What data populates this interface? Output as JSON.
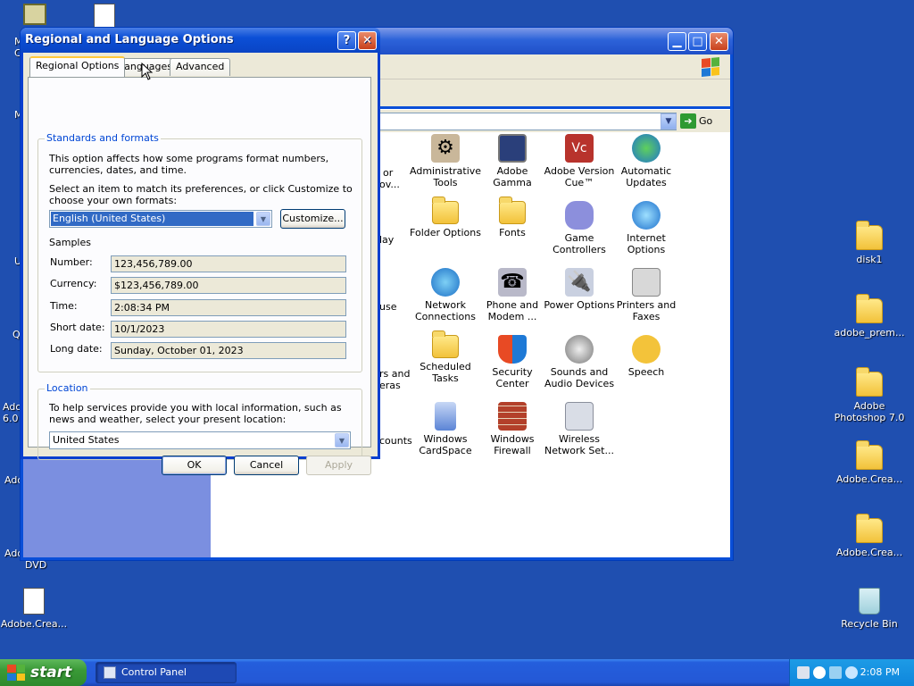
{
  "desktop": {
    "icons_right": [
      {
        "label": "disk1"
      },
      {
        "label": "adobe_prem..."
      },
      {
        "label": "Adobe Photoshop 7.0"
      },
      {
        "label": "Adobe.Crea..."
      },
      {
        "label": "Adobe.Crea..."
      },
      {
        "label": "Recycle Bin"
      }
    ],
    "icon_bottom_left": {
      "label": "Adobe.Crea..."
    },
    "left_edge_fragments": [
      "M",
      "C",
      "M",
      "U",
      "Q",
      "Ado",
      "6.0",
      "Ado",
      "Ado",
      "DVD"
    ]
  },
  "control_panel": {
    "go_label": "Go",
    "items": [
      {
        "label": "Administrative Tools",
        "icon": "admin-tools-icon"
      },
      {
        "label": "Adobe Gamma",
        "icon": "adobe-gamma-icon"
      },
      {
        "label": "Adobe Version Cue™",
        "icon": "adobe-version-cue-icon"
      },
      {
        "label": "Automatic Updates",
        "icon": "automatic-updates-icon"
      },
      {
        "label": "Folder Options",
        "icon": "folder-options-icon"
      },
      {
        "label": "Fonts",
        "icon": "fonts-icon"
      },
      {
        "label": "Game Controllers",
        "icon": "game-controllers-icon"
      },
      {
        "label": "Internet Options",
        "icon": "internet-options-icon"
      },
      {
        "label": "Network Connections",
        "icon": "network-connections-icon"
      },
      {
        "label": "Phone and Modem ...",
        "icon": "phone-modem-icon"
      },
      {
        "label": "Power Options",
        "icon": "power-options-icon"
      },
      {
        "label": "Printers and Faxes",
        "icon": "printers-faxes-icon"
      },
      {
        "label": "Scheduled Tasks",
        "icon": "scheduled-tasks-icon"
      },
      {
        "label": "Security Center",
        "icon": "security-center-icon"
      },
      {
        "label": "Sounds and Audio Devices",
        "icon": "sounds-audio-icon"
      },
      {
        "label": "Speech",
        "icon": "speech-icon"
      },
      {
        "label": "Windows CardSpace",
        "icon": "windows-cardspace-icon"
      },
      {
        "label": "Windows Firewall",
        "icon": "windows-firewall-icon"
      },
      {
        "label": "Wireless Network Set...",
        "icon": "wireless-network-icon"
      }
    ],
    "partial_items": [
      "or",
      "ov...",
      "lay",
      "use",
      "rs and",
      "eras",
      "counts"
    ]
  },
  "dialog": {
    "title": "Regional and Language Options",
    "tabs": [
      "Regional Options",
      "Languages",
      "Advanced"
    ],
    "active_tab": "Regional Options",
    "standards": {
      "legend": "Standards and formats",
      "desc": "This option affects how some programs format numbers, currencies, dates, and time.",
      "instruction": "Select an item to match its preferences, or click Customize to choose your own formats:",
      "selected_format": "English (United States)",
      "customize_label": "Customize...",
      "samples_heading": "Samples",
      "samples": [
        {
          "label": "Number:",
          "value": "123,456,789.00"
        },
        {
          "label": "Currency:",
          "value": "$123,456,789.00"
        },
        {
          "label": "Time:",
          "value": "2:08:34 PM"
        },
        {
          "label": "Short date:",
          "value": "10/1/2023"
        },
        {
          "label": "Long date:",
          "value": "Sunday, October 01, 2023"
        }
      ]
    },
    "location": {
      "legend": "Location",
      "desc": "To help services provide you with local information, such as news and weather, select your present location:",
      "selected": "United States"
    },
    "buttons": {
      "ok": "OK",
      "cancel": "Cancel",
      "apply": "Apply"
    }
  },
  "taskbar": {
    "start_label": "start",
    "tasks": [
      {
        "label": "Control Panel"
      }
    ],
    "clock": "2:08 PM"
  }
}
